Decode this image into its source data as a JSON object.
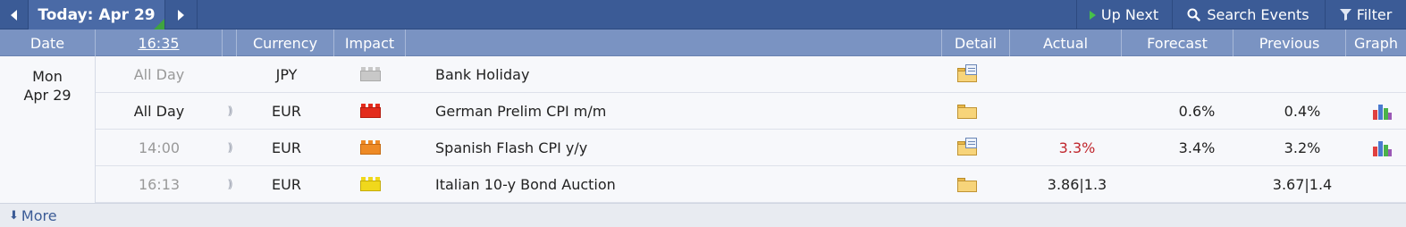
{
  "nav": {
    "today_label": "Today: Apr 29",
    "up_next_label": "Up Next",
    "search_label": "Search Events",
    "filter_label": "Filter"
  },
  "headers": {
    "date": "Date",
    "time": "16:35",
    "currency": "Currency",
    "impact": "Impact",
    "detail": "Detail",
    "actual": "Actual",
    "forecast": "Forecast",
    "previous": "Previous",
    "graph": "Graph"
  },
  "day": {
    "weekday": "Mon",
    "date": "Apr 29"
  },
  "events": [
    {
      "time": "All Day",
      "currency": "JPY",
      "impact": "holiday",
      "impact_color": "#c8c8c8",
      "name": "Bank Holiday",
      "detail_icon": "folder-document-icon",
      "actual": "",
      "forecast": "",
      "previous": ""
    },
    {
      "time": "All Day",
      "currency": "EUR",
      "impact": "high",
      "impact_color": "#e32b1c",
      "name": "German Prelim CPI m/m",
      "detail_icon": "folder-icon",
      "actual": "",
      "forecast": "0.6%",
      "previous": "0.4%"
    },
    {
      "time": "14:00",
      "currency": "EUR",
      "impact": "medium",
      "impact_color": "#ee8a25",
      "name": "Spanish Flash CPI y/y",
      "detail_icon": "folder-document-icon",
      "actual": "3.3%",
      "actual_color": "#c0262d",
      "forecast": "3.4%",
      "previous": "3.2%"
    },
    {
      "time": "16:13",
      "currency": "EUR",
      "impact": "low",
      "impact_color": "#f0d81c",
      "name": "Italian 10-y Bond Auction",
      "detail_icon": "folder-icon",
      "actual": "3.86|1.3",
      "forecast": "",
      "previous": "3.67|1.4"
    }
  ],
  "footer": {
    "more_label": "More"
  }
}
